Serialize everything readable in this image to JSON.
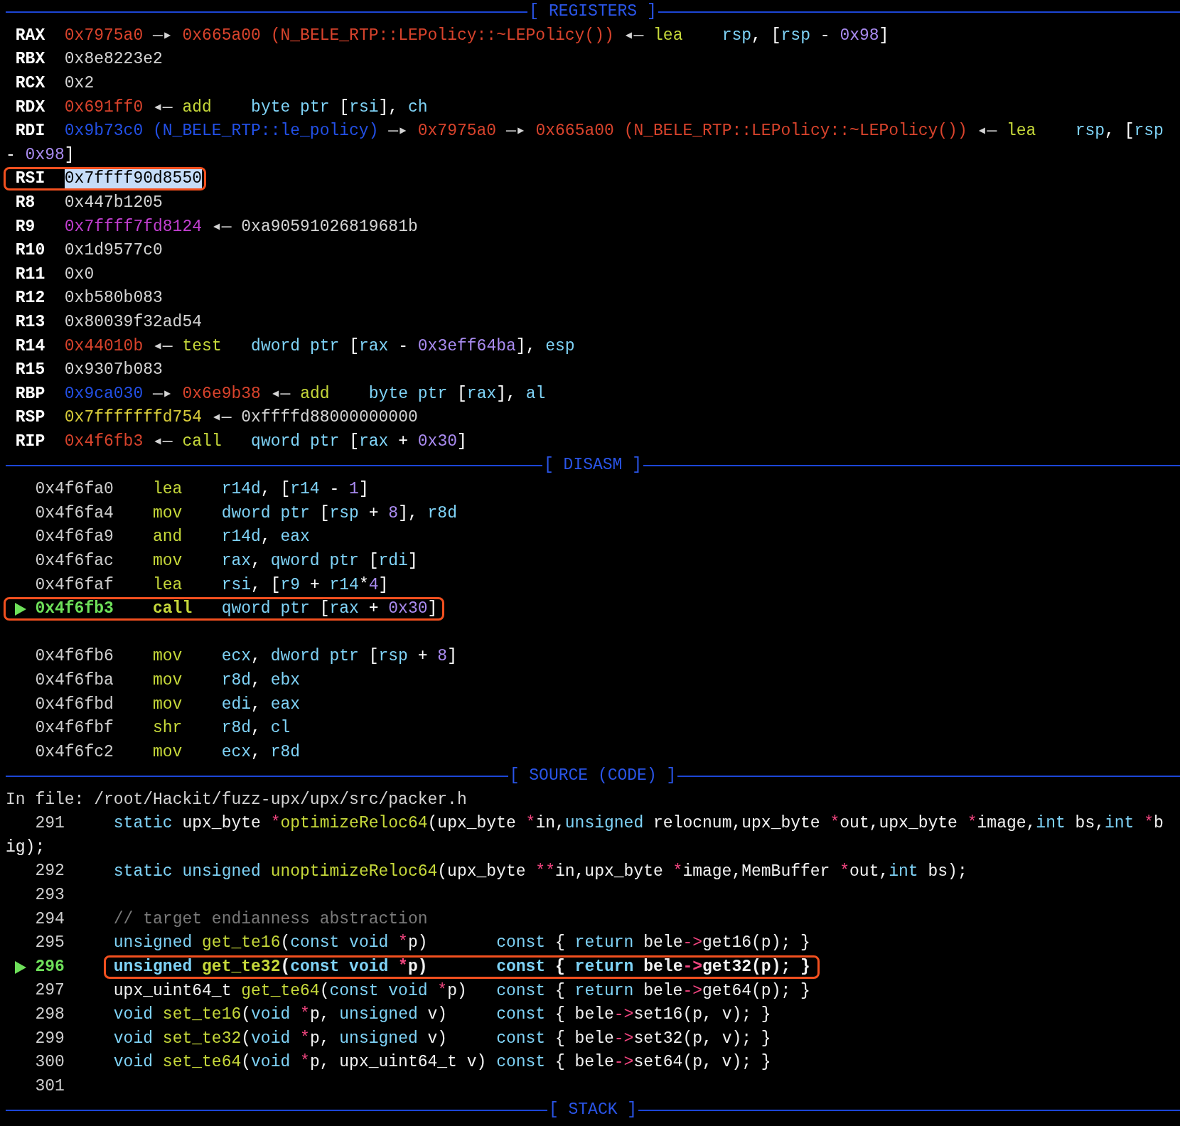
{
  "registers": {
    "title": "[ REGISTERS ]",
    "rows": [
      {
        "name": "RAX",
        "boxed": false,
        "value": [
          {
            "t": "0x7975a0",
            "kind": "code"
          },
          {
            "t": " —▸ ",
            "kind": "arrow"
          },
          {
            "t": "0x665a00 (N_BELE_RTP::LEPolicy::~LEPolicy())",
            "kind": "code"
          },
          {
            "t": " ◂— ",
            "kind": "arrow"
          },
          {
            "t": "lea    ",
            "kind": "mnemonic"
          },
          {
            "t": "rsp",
            "kind": "operand"
          },
          {
            "t": ", [",
            "kind": "punct"
          },
          {
            "t": "rsp",
            "kind": "operand"
          },
          {
            "t": " - ",
            "kind": "punct"
          },
          {
            "t": "0x98",
            "kind": "number"
          },
          {
            "t": "]",
            "kind": "punct"
          }
        ]
      },
      {
        "name": "RBX",
        "boxed": false,
        "value": [
          {
            "t": "0x8e8223e2",
            "kind": "plain"
          }
        ]
      },
      {
        "name": "RCX",
        "boxed": false,
        "value": [
          {
            "t": "0x2",
            "kind": "plain"
          }
        ]
      },
      {
        "name": "RDX",
        "boxed": false,
        "value": [
          {
            "t": "0x691ff0",
            "kind": "code"
          },
          {
            "t": " ◂— ",
            "kind": "arrow"
          },
          {
            "t": "add    ",
            "kind": "mnemonic"
          },
          {
            "t": "byte ptr",
            "kind": "operand"
          },
          {
            "t": " [",
            "kind": "punct"
          },
          {
            "t": "rsi",
            "kind": "operand"
          },
          {
            "t": "], ",
            "kind": "punct"
          },
          {
            "t": "ch",
            "kind": "operand"
          }
        ]
      },
      {
        "name": "RDI",
        "boxed": false,
        "value": [
          {
            "t": "0x9b73c0 (N_BELE_RTP::le_policy)",
            "kind": "heap"
          },
          {
            "t": " —▸ ",
            "kind": "arrow"
          },
          {
            "t": "0x7975a0",
            "kind": "code"
          },
          {
            "t": " —▸ ",
            "kind": "arrow"
          },
          {
            "t": "0x665a00 (N_BELE_RTP::LEPolicy::~LEPolicy())",
            "kind": "code"
          },
          {
            "t": " ◂— ",
            "kind": "arrow"
          },
          {
            "t": "lea    ",
            "kind": "mnemonic"
          },
          {
            "t": "rsp",
            "kind": "operand"
          },
          {
            "t": ", [",
            "kind": "punct"
          },
          {
            "t": "rsp",
            "kind": "operand"
          }
        ],
        "continuation": [
          {
            "t": "- ",
            "kind": "punct"
          },
          {
            "t": "0x98",
            "kind": "number"
          },
          {
            "t": "]",
            "kind": "punct"
          }
        ]
      },
      {
        "name": "RSI",
        "boxed": true,
        "value": [
          {
            "t": "0x7ffff90d8550",
            "kind": "selection"
          }
        ]
      },
      {
        "name": "R8",
        "boxed": false,
        "value": [
          {
            "t": "0x447b1205",
            "kind": "plain"
          }
        ]
      },
      {
        "name": "R9",
        "boxed": false,
        "value": [
          {
            "t": "0x7ffff7fd8124",
            "kind": "data"
          },
          {
            "t": " ◂— ",
            "kind": "arrow"
          },
          {
            "t": "0xa90591026819681b",
            "kind": "plain"
          }
        ]
      },
      {
        "name": "R10",
        "boxed": false,
        "value": [
          {
            "t": "0x1d9577c0",
            "kind": "plain"
          }
        ]
      },
      {
        "name": "R11",
        "boxed": false,
        "value": [
          {
            "t": "0x0",
            "kind": "plain"
          }
        ]
      },
      {
        "name": "R12",
        "boxed": false,
        "value": [
          {
            "t": "0xb580b083",
            "kind": "plain"
          }
        ]
      },
      {
        "name": "R13",
        "boxed": false,
        "value": [
          {
            "t": "0x80039f32ad54",
            "kind": "plain"
          }
        ]
      },
      {
        "name": "R14",
        "boxed": false,
        "value": [
          {
            "t": "0x44010b",
            "kind": "code"
          },
          {
            "t": " ◂— ",
            "kind": "arrow"
          },
          {
            "t": "test   ",
            "kind": "mnemonic"
          },
          {
            "t": "dword ptr",
            "kind": "operand"
          },
          {
            "t": " [",
            "kind": "punct"
          },
          {
            "t": "rax",
            "kind": "operand"
          },
          {
            "t": " - ",
            "kind": "punct"
          },
          {
            "t": "0x3eff64ba",
            "kind": "number"
          },
          {
            "t": "], ",
            "kind": "punct"
          },
          {
            "t": "esp",
            "kind": "operand"
          }
        ]
      },
      {
        "name": "R15",
        "boxed": false,
        "value": [
          {
            "t": "0x9307b083",
            "kind": "plain"
          }
        ]
      },
      {
        "name": "RBP",
        "boxed": false,
        "value": [
          {
            "t": "0x9ca030",
            "kind": "heap"
          },
          {
            "t": " —▸ ",
            "kind": "arrow"
          },
          {
            "t": "0x6e9b38",
            "kind": "code"
          },
          {
            "t": " ◂— ",
            "kind": "arrow"
          },
          {
            "t": "add    ",
            "kind": "mnemonic"
          },
          {
            "t": "byte ptr",
            "kind": "operand"
          },
          {
            "t": " [",
            "kind": "punct"
          },
          {
            "t": "rax",
            "kind": "operand"
          },
          {
            "t": "], ",
            "kind": "punct"
          },
          {
            "t": "al",
            "kind": "operand"
          }
        ]
      },
      {
        "name": "RSP",
        "boxed": false,
        "value": [
          {
            "t": "0x7fffffffd754",
            "kind": "stack"
          },
          {
            "t": " ◂— ",
            "kind": "arrow"
          },
          {
            "t": "0xffffd88000000000",
            "kind": "plain"
          }
        ]
      },
      {
        "name": "RIP",
        "boxed": false,
        "value": [
          {
            "t": "0x4f6fb3",
            "kind": "code"
          },
          {
            "t": " ◂— ",
            "kind": "arrow"
          },
          {
            "t": "call   ",
            "kind": "mnemonic"
          },
          {
            "t": "qword ptr",
            "kind": "operand"
          },
          {
            "t": " [",
            "kind": "punct"
          },
          {
            "t": "rax",
            "kind": "operand"
          },
          {
            "t": " + ",
            "kind": "punct"
          },
          {
            "t": "0x30",
            "kind": "number"
          },
          {
            "t": "]",
            "kind": "punct"
          }
        ]
      }
    ]
  },
  "disasm": {
    "title": "[ DISASM ]",
    "rows": [
      {
        "kind": "instr",
        "current": false,
        "boxed": false,
        "address": "0x4f6fa0",
        "mnemonic": "lea",
        "operands": [
          {
            "t": "r14d",
            "kind": "operand"
          },
          {
            "t": ", [",
            "kind": "punct"
          },
          {
            "t": "r14",
            "kind": "operand"
          },
          {
            "t": " - ",
            "kind": "punct"
          },
          {
            "t": "1",
            "kind": "number"
          },
          {
            "t": "]",
            "kind": "punct"
          }
        ]
      },
      {
        "kind": "instr",
        "current": false,
        "boxed": false,
        "address": "0x4f6fa4",
        "mnemonic": "mov",
        "operands": [
          {
            "t": "dword ptr",
            "kind": "operand"
          },
          {
            "t": " [",
            "kind": "punct"
          },
          {
            "t": "rsp",
            "kind": "operand"
          },
          {
            "t": " + ",
            "kind": "punct"
          },
          {
            "t": "8",
            "kind": "number"
          },
          {
            "t": "], ",
            "kind": "punct"
          },
          {
            "t": "r8d",
            "kind": "operand"
          }
        ]
      },
      {
        "kind": "instr",
        "current": false,
        "boxed": false,
        "address": "0x4f6fa9",
        "mnemonic": "and",
        "operands": [
          {
            "t": "r14d",
            "kind": "operand"
          },
          {
            "t": ", ",
            "kind": "punct"
          },
          {
            "t": "eax",
            "kind": "operand"
          }
        ]
      },
      {
        "kind": "instr",
        "current": false,
        "boxed": false,
        "address": "0x4f6fac",
        "mnemonic": "mov",
        "operands": [
          {
            "t": "rax",
            "kind": "operand"
          },
          {
            "t": ", ",
            "kind": "punct"
          },
          {
            "t": "qword ptr",
            "kind": "operand"
          },
          {
            "t": " [",
            "kind": "punct"
          },
          {
            "t": "rdi",
            "kind": "operand"
          },
          {
            "t": "]",
            "kind": "punct"
          }
        ]
      },
      {
        "kind": "instr",
        "current": false,
        "boxed": false,
        "address": "0x4f6faf",
        "mnemonic": "lea",
        "operands": [
          {
            "t": "rsi",
            "kind": "operand"
          },
          {
            "t": ", [",
            "kind": "punct"
          },
          {
            "t": "r9",
            "kind": "operand"
          },
          {
            "t": " + ",
            "kind": "punct"
          },
          {
            "t": "r14",
            "kind": "operand"
          },
          {
            "t": "*",
            "kind": "punct"
          },
          {
            "t": "4",
            "kind": "number"
          },
          {
            "t": "]",
            "kind": "punct"
          }
        ]
      },
      {
        "kind": "instr",
        "current": true,
        "boxed": true,
        "address": "0x4f6fb3",
        "mnemonic": "call",
        "operands": [
          {
            "t": "qword ptr",
            "kind": "operand"
          },
          {
            "t": " [",
            "kind": "punct"
          },
          {
            "t": "rax",
            "kind": "operand"
          },
          {
            "t": " + ",
            "kind": "punct"
          },
          {
            "t": "0x30",
            "kind": "number"
          },
          {
            "t": "]",
            "kind": "punct"
          }
        ]
      },
      {
        "kind": "gap"
      },
      {
        "kind": "instr",
        "current": false,
        "boxed": false,
        "address": "0x4f6fb6",
        "mnemonic": "mov",
        "operands": [
          {
            "t": "ecx",
            "kind": "operand"
          },
          {
            "t": ", ",
            "kind": "punct"
          },
          {
            "t": "dword ptr",
            "kind": "operand"
          },
          {
            "t": " [",
            "kind": "punct"
          },
          {
            "t": "rsp",
            "kind": "operand"
          },
          {
            "t": " + ",
            "kind": "punct"
          },
          {
            "t": "8",
            "kind": "number"
          },
          {
            "t": "]",
            "kind": "punct"
          }
        ]
      },
      {
        "kind": "instr",
        "current": false,
        "boxed": false,
        "address": "0x4f6fba",
        "mnemonic": "mov",
        "operands": [
          {
            "t": "r8d",
            "kind": "operand"
          },
          {
            "t": ", ",
            "kind": "punct"
          },
          {
            "t": "ebx",
            "kind": "operand"
          }
        ]
      },
      {
        "kind": "instr",
        "current": false,
        "boxed": false,
        "address": "0x4f6fbd",
        "mnemonic": "mov",
        "operands": [
          {
            "t": "edi",
            "kind": "operand"
          },
          {
            "t": ", ",
            "kind": "punct"
          },
          {
            "t": "eax",
            "kind": "operand"
          }
        ]
      },
      {
        "kind": "instr",
        "current": false,
        "boxed": false,
        "address": "0x4f6fbf",
        "mnemonic": "shr",
        "operands": [
          {
            "t": "r8d",
            "kind": "operand"
          },
          {
            "t": ", ",
            "kind": "punct"
          },
          {
            "t": "cl",
            "kind": "operand"
          }
        ]
      },
      {
        "kind": "instr",
        "current": false,
        "boxed": false,
        "address": "0x4f6fc2",
        "mnemonic": "mov",
        "operands": [
          {
            "t": "ecx",
            "kind": "operand"
          },
          {
            "t": ", ",
            "kind": "punct"
          },
          {
            "t": "r8d",
            "kind": "operand"
          }
        ]
      }
    ]
  },
  "source": {
    "title": "[ SOURCE (CODE) ]",
    "file_label": "In file: /root/Hackit/fuzz-upx/upx/src/packer.h",
    "lines": [
      {
        "number": "291",
        "current": false,
        "boxed": false,
        "tokens": [
          {
            "t": "static",
            "kind": "kw"
          },
          {
            "t": " upx_byte ",
            "kind": "text"
          },
          {
            "t": "*",
            "kind": "op"
          },
          {
            "t": "optimizeReloc64",
            "kind": "func"
          },
          {
            "t": "(upx_byte ",
            "kind": "text"
          },
          {
            "t": "*",
            "kind": "op"
          },
          {
            "t": "in,",
            "kind": "text"
          },
          {
            "t": "unsigned",
            "kind": "kw"
          },
          {
            "t": " relocnum,upx_byte ",
            "kind": "text"
          },
          {
            "t": "*",
            "kind": "op"
          },
          {
            "t": "out,upx_byte ",
            "kind": "text"
          },
          {
            "t": "*",
            "kind": "op"
          },
          {
            "t": "image,",
            "kind": "text"
          },
          {
            "t": "int",
            "kind": "kw"
          },
          {
            "t": " bs,",
            "kind": "text"
          },
          {
            "t": "int ",
            "kind": "kw"
          },
          {
            "t": "*",
            "kind": "op"
          },
          {
            "t": "b",
            "kind": "text"
          }
        ],
        "continuation": [
          {
            "t": "ig);",
            "kind": "text"
          }
        ]
      },
      {
        "number": "292",
        "current": false,
        "boxed": false,
        "tokens": [
          {
            "t": "static unsigned ",
            "kind": "kw"
          },
          {
            "t": "unoptimizeReloc64",
            "kind": "func"
          },
          {
            "t": "(upx_byte ",
            "kind": "text"
          },
          {
            "t": "**",
            "kind": "op"
          },
          {
            "t": "in,upx_byte ",
            "kind": "text"
          },
          {
            "t": "*",
            "kind": "op"
          },
          {
            "t": "image,MemBuffer ",
            "kind": "text"
          },
          {
            "t": "*",
            "kind": "op"
          },
          {
            "t": "out,",
            "kind": "text"
          },
          {
            "t": "int",
            "kind": "kw"
          },
          {
            "t": " bs);",
            "kind": "text"
          }
        ]
      },
      {
        "number": "293",
        "current": false,
        "boxed": false
      },
      {
        "number": "294",
        "current": false,
        "boxed": false,
        "tokens": [
          {
            "t": "// target endianness abstraction",
            "kind": "comment"
          }
        ]
      },
      {
        "number": "295",
        "current": false,
        "boxed": false,
        "tokens": [
          {
            "t": "unsigned ",
            "kind": "kw"
          },
          {
            "t": "get_te16",
            "kind": "func"
          },
          {
            "t": "(",
            "kind": "text"
          },
          {
            "t": "const void ",
            "kind": "kw"
          },
          {
            "t": "*",
            "kind": "op"
          },
          {
            "t": "p)       ",
            "kind": "text"
          },
          {
            "t": "const",
            "kind": "kw"
          },
          {
            "t": " { ",
            "kind": "text"
          },
          {
            "t": "return",
            "kind": "kw"
          },
          {
            "t": " bele",
            "kind": "text"
          },
          {
            "t": "->",
            "kind": "op"
          },
          {
            "t": "get16(p); }",
            "kind": "text"
          }
        ]
      },
      {
        "number": "296",
        "current": true,
        "boxed": true,
        "tokens": [
          {
            "t": "unsigned ",
            "kind": "kw"
          },
          {
            "t": "get_te32",
            "kind": "func"
          },
          {
            "t": "(",
            "kind": "text"
          },
          {
            "t": "const void ",
            "kind": "kw"
          },
          {
            "t": "*",
            "kind": "op"
          },
          {
            "t": "p)       ",
            "kind": "text"
          },
          {
            "t": "const",
            "kind": "kw"
          },
          {
            "t": " { ",
            "kind": "text"
          },
          {
            "t": "return",
            "kind": "kw"
          },
          {
            "t": " bele",
            "kind": "text"
          },
          {
            "t": "->",
            "kind": "op"
          },
          {
            "t": "get32(p); }",
            "kind": "text"
          }
        ]
      },
      {
        "number": "297",
        "current": false,
        "boxed": false,
        "tokens": [
          {
            "t": "upx_uint64_t ",
            "kind": "text"
          },
          {
            "t": "get_te64",
            "kind": "func"
          },
          {
            "t": "(",
            "kind": "text"
          },
          {
            "t": "const void ",
            "kind": "kw"
          },
          {
            "t": "*",
            "kind": "op"
          },
          {
            "t": "p)   ",
            "kind": "text"
          },
          {
            "t": "const",
            "kind": "kw"
          },
          {
            "t": " { ",
            "kind": "text"
          },
          {
            "t": "return",
            "kind": "kw"
          },
          {
            "t": " bele",
            "kind": "text"
          },
          {
            "t": "->",
            "kind": "op"
          },
          {
            "t": "get64(p); }",
            "kind": "text"
          }
        ]
      },
      {
        "number": "298",
        "current": false,
        "boxed": false,
        "tokens": [
          {
            "t": "void ",
            "kind": "kw"
          },
          {
            "t": "set_te16",
            "kind": "func"
          },
          {
            "t": "(",
            "kind": "text"
          },
          {
            "t": "void ",
            "kind": "kw"
          },
          {
            "t": "*",
            "kind": "op"
          },
          {
            "t": "p, ",
            "kind": "text"
          },
          {
            "t": "unsigned",
            "kind": "kw"
          },
          {
            "t": " v)     ",
            "kind": "text"
          },
          {
            "t": "const",
            "kind": "kw"
          },
          {
            "t": " { bele",
            "kind": "text"
          },
          {
            "t": "->",
            "kind": "op"
          },
          {
            "t": "set16(p, v); }",
            "kind": "text"
          }
        ]
      },
      {
        "number": "299",
        "current": false,
        "boxed": false,
        "tokens": [
          {
            "t": "void ",
            "kind": "kw"
          },
          {
            "t": "set_te32",
            "kind": "func"
          },
          {
            "t": "(",
            "kind": "text"
          },
          {
            "t": "void ",
            "kind": "kw"
          },
          {
            "t": "*",
            "kind": "op"
          },
          {
            "t": "p, ",
            "kind": "text"
          },
          {
            "t": "unsigned",
            "kind": "kw"
          },
          {
            "t": " v)     ",
            "kind": "text"
          },
          {
            "t": "const",
            "kind": "kw"
          },
          {
            "t": " { bele",
            "kind": "text"
          },
          {
            "t": "->",
            "kind": "op"
          },
          {
            "t": "set32(p, v); }",
            "kind": "text"
          }
        ]
      },
      {
        "number": "300",
        "current": false,
        "boxed": false,
        "tokens": [
          {
            "t": "void ",
            "kind": "kw"
          },
          {
            "t": "set_te64",
            "kind": "func"
          },
          {
            "t": "(",
            "kind": "text"
          },
          {
            "t": "void ",
            "kind": "kw"
          },
          {
            "t": "*",
            "kind": "op"
          },
          {
            "t": "p, upx_uint64_t v) ",
            "kind": "text"
          },
          {
            "t": "const",
            "kind": "kw"
          },
          {
            "t": " { bele",
            "kind": "text"
          },
          {
            "t": "->",
            "kind": "op"
          },
          {
            "t": "set64(p, v); }",
            "kind": "text"
          }
        ]
      },
      {
        "number": "301",
        "current": false,
        "boxed": false
      }
    ]
  },
  "stack": {
    "title": "[ STACK ]"
  }
}
